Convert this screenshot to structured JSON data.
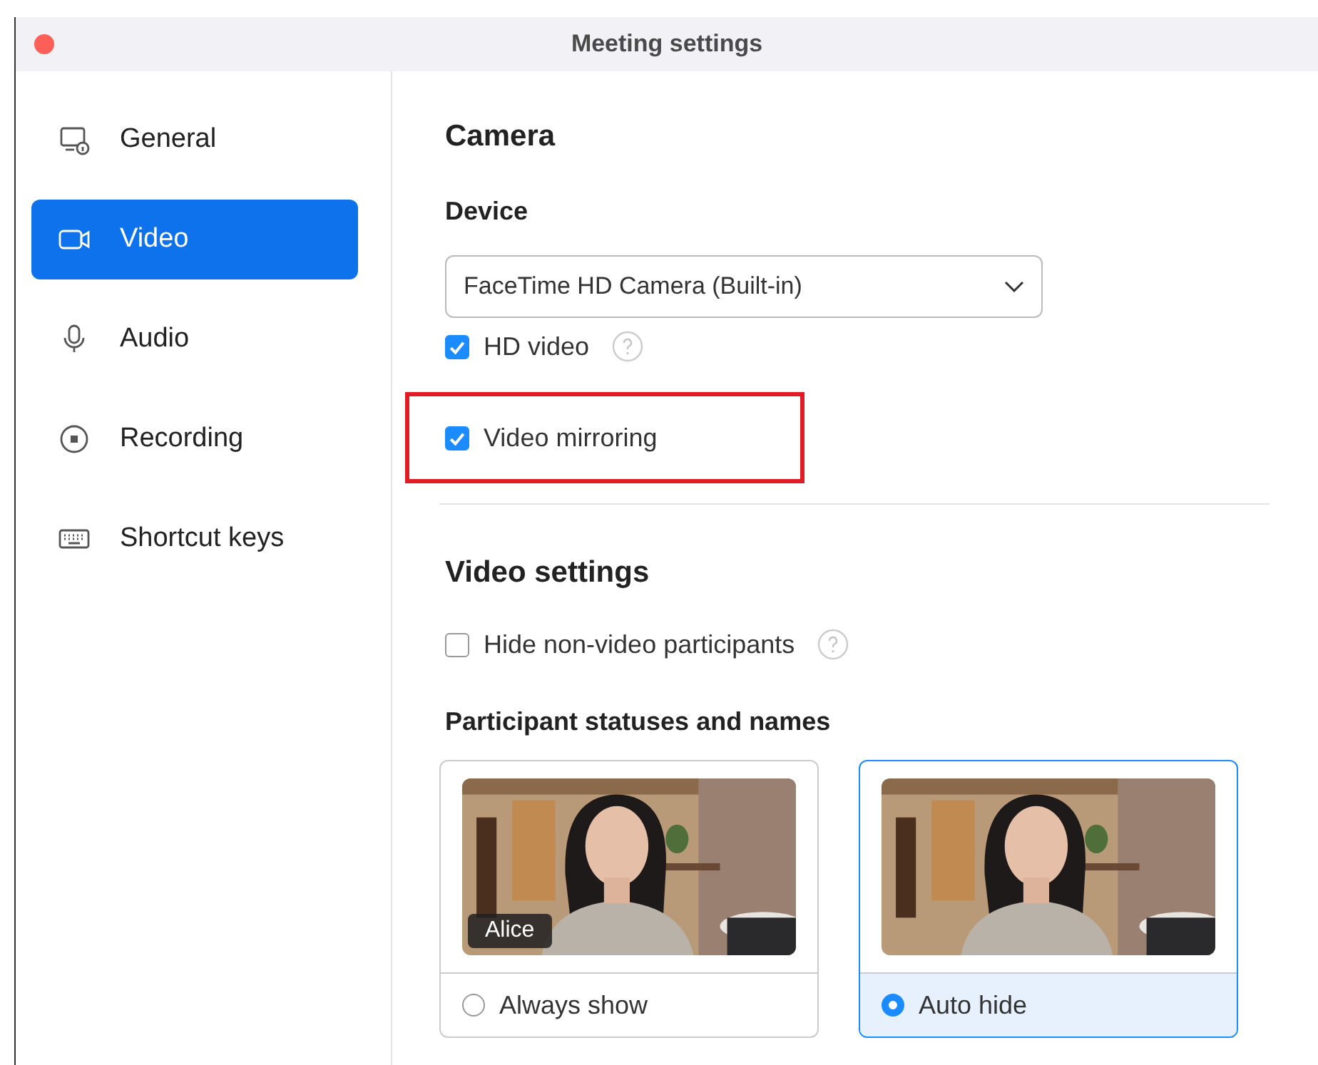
{
  "window": {
    "title": "Meeting settings"
  },
  "sidebar": {
    "items": [
      {
        "label": "General",
        "kind": "monitor",
        "selected": false
      },
      {
        "label": "Video",
        "kind": "camera",
        "selected": true
      },
      {
        "label": "Audio",
        "kind": "mic",
        "selected": false
      },
      {
        "label": "Recording",
        "kind": "record",
        "selected": false
      },
      {
        "label": "Shortcut keys",
        "kind": "keyboard",
        "selected": false
      }
    ]
  },
  "camera": {
    "title": "Camera",
    "device_label": "Device",
    "device": "FaceTime HD Camera (Built-in)",
    "options": [
      {
        "label": "HD video",
        "checked": true,
        "help": true,
        "highlighted": false
      },
      {
        "label": "Video mirroring",
        "checked": true,
        "help": false,
        "highlighted": true
      }
    ]
  },
  "video_settings": {
    "title": "Video settings",
    "options": [
      {
        "label": "Hide non-video participants",
        "checked": false,
        "help": true
      }
    ],
    "statuses": {
      "title": "Participant statuses and names",
      "choices": [
        {
          "label": "Always show",
          "selected": false,
          "name_tag": "Alice"
        },
        {
          "label": "Auto hide",
          "selected": true
        }
      ]
    }
  }
}
